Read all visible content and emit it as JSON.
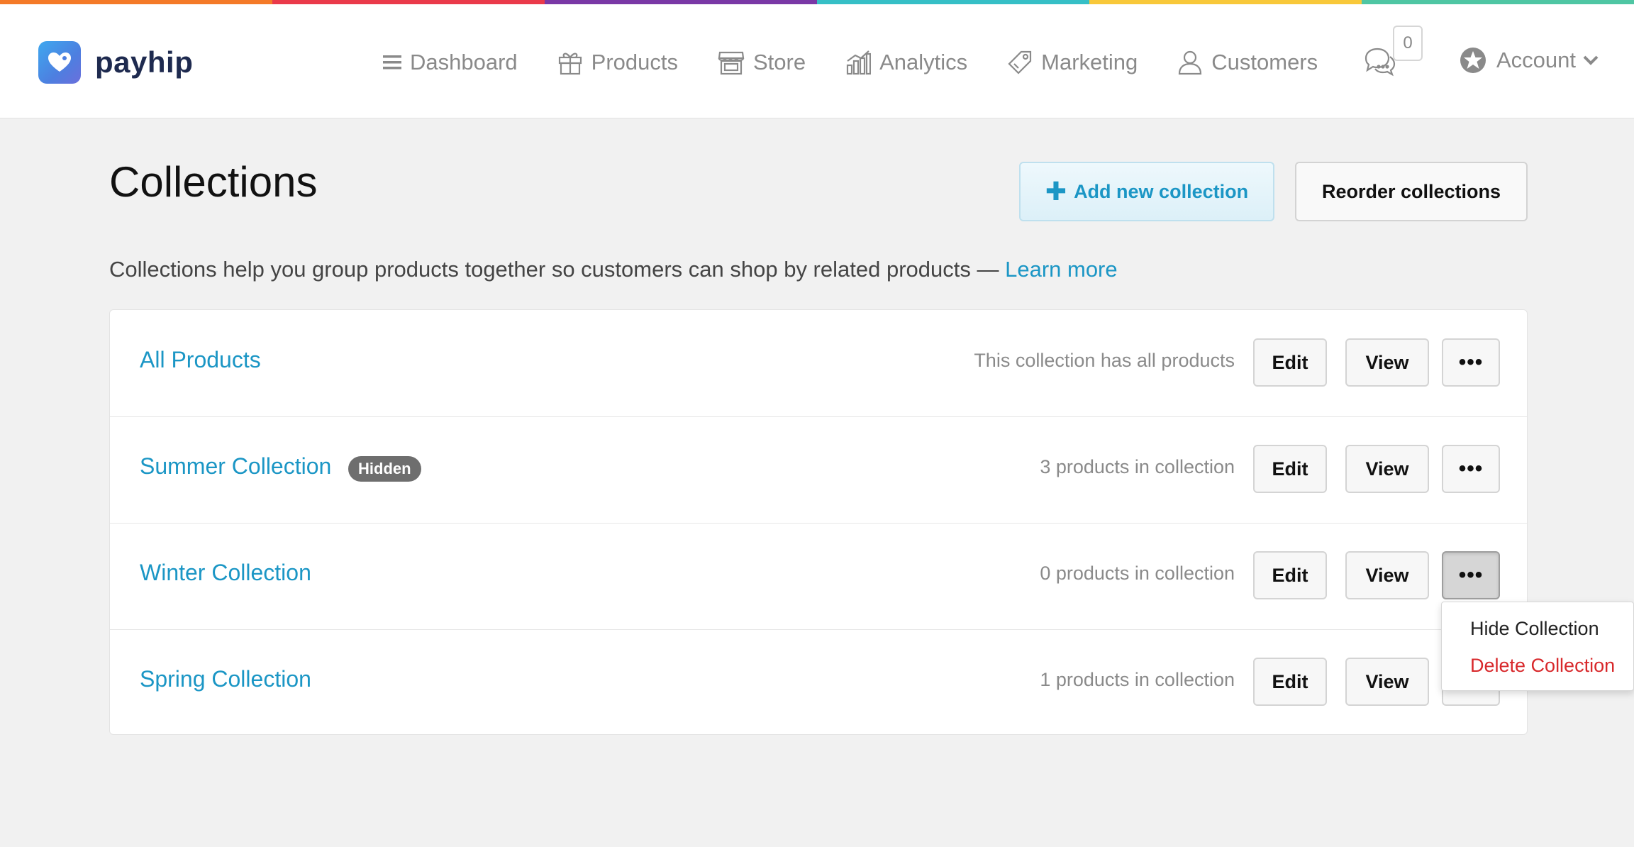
{
  "colors": {
    "rainbow": [
      "#f47a28",
      "#ea3a4a",
      "#7a38a6",
      "#36bfc6",
      "#f8c83a",
      "#4fc6a3"
    ],
    "accent": "#1b96c5",
    "danger": "#d8282b",
    "brand_dark": "#1e2a4f"
  },
  "header": {
    "logo_text": "payhip",
    "nav": [
      {
        "label": "Dashboard",
        "icon": "menu-icon"
      },
      {
        "label": "Products",
        "icon": "gift-icon"
      },
      {
        "label": "Store",
        "icon": "store-icon"
      },
      {
        "label": "Analytics",
        "icon": "chart-icon"
      },
      {
        "label": "Marketing",
        "icon": "tag-icon"
      },
      {
        "label": "Customers",
        "icon": "user-icon"
      }
    ],
    "messages_icon": "chat-icon",
    "messages_count": "0",
    "account_label": "Account",
    "account_icon": "star-icon"
  },
  "page": {
    "title": "Collections",
    "add_button": "Add new collection",
    "reorder_button": "Reorder collections",
    "intro": "Collections help you group products together so customers can shop by related products — ",
    "learn_more": "Learn more"
  },
  "collections": [
    {
      "name": "All Products",
      "badge": "",
      "count": "This collection has all products"
    },
    {
      "name": "Summer Collection",
      "badge": "Hidden",
      "count": "3 products in collection"
    },
    {
      "name": "Winter Collection",
      "badge": "",
      "count": "0 products in collection"
    },
    {
      "name": "Spring Collection",
      "badge": "",
      "count": "1 products in collection"
    }
  ],
  "row_buttons": {
    "edit": "Edit",
    "view": "View",
    "more": "•••"
  },
  "dropdown": {
    "hide": "Hide Collection",
    "delete": "Delete Collection"
  }
}
